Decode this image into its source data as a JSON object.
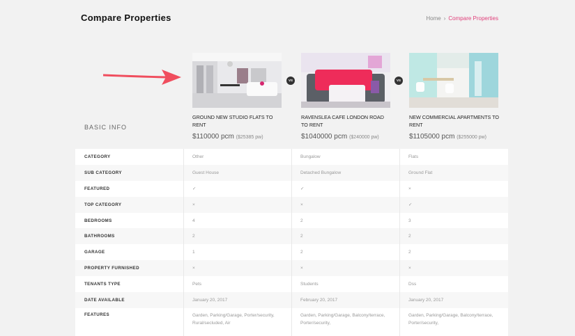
{
  "header": {
    "title": "Compare Properties",
    "breadcrumb": {
      "home": "Home",
      "separator": "›",
      "current": "Compare Properties"
    }
  },
  "section_label": "BASIC INFO",
  "vs_label": "VS",
  "colors": {
    "accent": "#e0407b",
    "arrow": "#f04e5e"
  },
  "properties": [
    {
      "name": "GROUND NEW STUDIO FLATS TO RENT",
      "price": "$110000 pcm",
      "pw": "($25385 pw)"
    },
    {
      "name": "RAVENSLEA CAFE LONDON ROAD TO RENT",
      "price": "$1040000 pcm",
      "pw": "($240000 pw)"
    },
    {
      "name": "NEW COMMERCIAL APARTMENTS TO RENT",
      "price": "$1105000 pcm",
      "pw": "($255000 pw)"
    }
  ],
  "rows": [
    {
      "label": "CATEGORY",
      "values": [
        "Other",
        "Bungalow",
        "Flats"
      ]
    },
    {
      "label": "SUB CATEGORY",
      "values": [
        "Guest House",
        "Detached Bungalow",
        "Ground Flat"
      ]
    },
    {
      "label": "FEATURED",
      "values": [
        "✓",
        "✓",
        "×"
      ]
    },
    {
      "label": "TOP CATEGORY",
      "values": [
        "×",
        "×",
        "✓"
      ]
    },
    {
      "label": "BEDROOMS",
      "values": [
        "4",
        "2",
        "3"
      ]
    },
    {
      "label": "BATHROOMS",
      "values": [
        "2",
        "2",
        "2"
      ]
    },
    {
      "label": "GARAGE",
      "values": [
        "1",
        "2",
        "2"
      ]
    },
    {
      "label": "PROPERTY FURNISHED",
      "values": [
        "×",
        "×",
        "×"
      ]
    },
    {
      "label": "TENANTS TYPE",
      "values": [
        "Pets",
        "Students",
        "Dss"
      ]
    },
    {
      "label": "DATE AVAILABLE",
      "values": [
        "January 20, 2017",
        "February 20, 2017",
        "January 20, 2017"
      ]
    },
    {
      "label": "FEATURES",
      "values": [
        "Garden, Parking/Garage, Porter/security, Rural/secluded, Air",
        "Garden, Parking/Garage, Balcony/terrace, Porter/security,",
        "Garden, Parking/Garage, Balcony/terrace, Porter/security,"
      ]
    }
  ]
}
